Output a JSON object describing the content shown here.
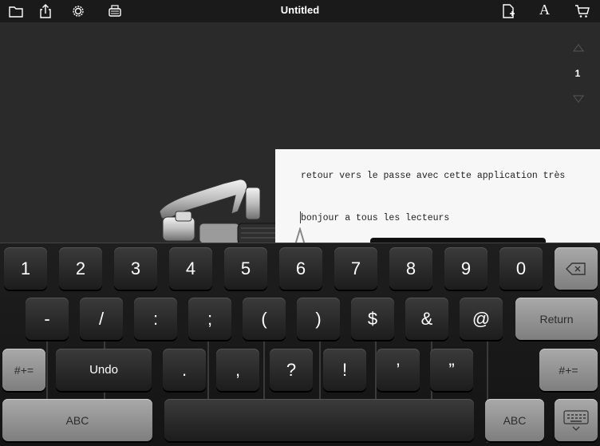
{
  "toolbar": {
    "title": "Untitled",
    "icons": [
      "folder-icon",
      "share-icon",
      "gear-icon",
      "typewriter-icon",
      "new-page-icon",
      "font-icon",
      "cart-icon"
    ],
    "font_label": "A"
  },
  "pager": {
    "current_page": "1"
  },
  "paper": {
    "line1": "retour vers le passe avec cette application très",
    "line2": "bonjour a tous les lecteurs"
  },
  "keyboard": {
    "row1": [
      "1",
      "2",
      "3",
      "4",
      "5",
      "6",
      "7",
      "8",
      "9",
      "0"
    ],
    "row2": [
      "-",
      "/",
      ":",
      ";",
      "(",
      ")",
      "$",
      "&",
      "@"
    ],
    "return_label": "Return",
    "row3_left": "#+=",
    "undo_label": "Undo",
    "row3": [
      ".",
      ",",
      "?",
      "!",
      "’",
      "”"
    ],
    "row3_right": "#+=",
    "abc_left": "ABC",
    "abc_right": "ABC"
  },
  "colors": {
    "toolbar_bg": "#1a1a1a",
    "workspace_bg": "#2a2a2a",
    "paper_bg": "#f7f7f7",
    "key_dark": "#2b2b2b",
    "key_light": "#959595"
  }
}
